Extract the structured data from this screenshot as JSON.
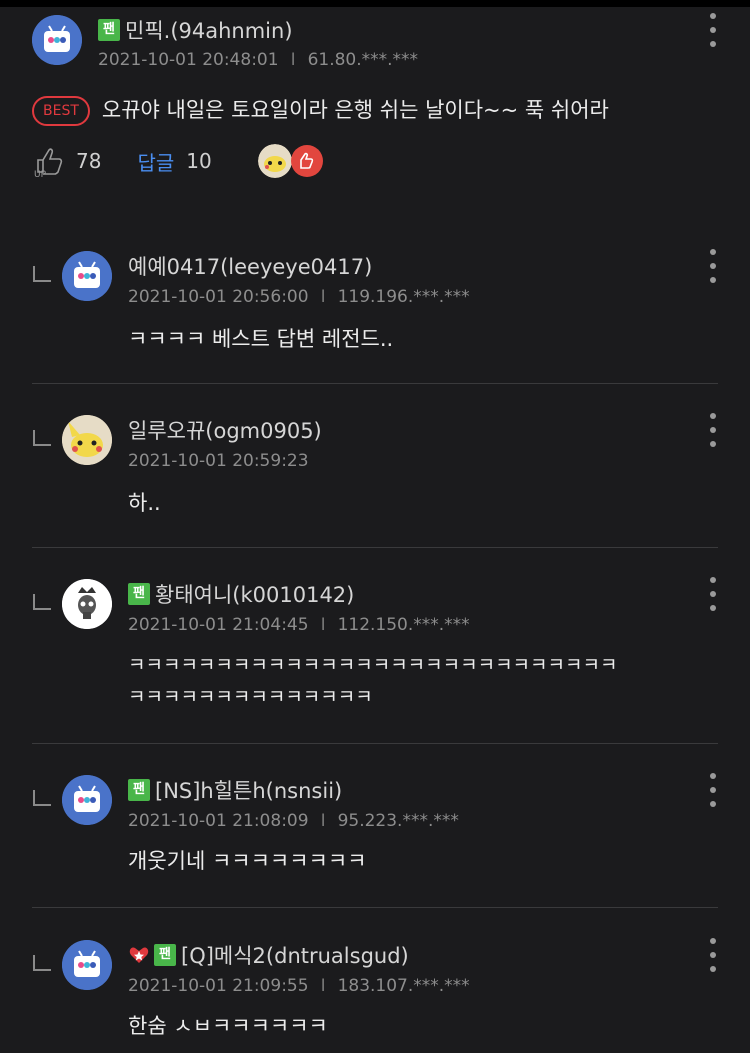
{
  "top_comment": {
    "fan_badge": "팬",
    "username": "민픽.(94ahnmin)",
    "datetime": "2021-10-01 20:48:01",
    "ip": "61.80.***.***",
    "best_label": "BEST",
    "text": "오뀨야 내일은 토요일이라 은행 쉬는 날이다~~ 푹 쉬어라",
    "like_count": "78",
    "reply_label": "답글",
    "reply_count": "10"
  },
  "replies": [
    {
      "username": "예예0417(leeyeye0417)",
      "datetime": "2021-10-01 20:56:00",
      "ip": "119.196.***.***",
      "text": "ㅋㅋㅋㅋ 베스트 답변 레전드..",
      "fan": false
    },
    {
      "username": "일루오뀨(ogm0905)",
      "datetime": "2021-10-01 20:59:23",
      "ip": "",
      "text": "하..",
      "fan": false
    },
    {
      "username": "황태여니(k0010142)",
      "datetime": "2021-10-01 21:04:45",
      "ip": "112.150.***.***",
      "text": "ㅋㅋㅋㅋㅋㅋㅋㅋㅋㅋㅋㅋㅋㅋㅋㅋㅋㅋㅋㅋㅋㅋㅋㅋㅋㅋㅋㅋ",
      "text2": "ㅋㅋㅋㅋㅋㅋㅋㅋㅋㅋㅋㅋㅋㅋ",
      "fan": true,
      "fan_badge": "팬"
    },
    {
      "username": "[NS]h힐튼h(nsnsii)",
      "datetime": "2021-10-01 21:08:09",
      "ip": "95.223.***.***",
      "text": "개웃기네 ㅋㅋㅋㅋㅋㅋㅋㅋ",
      "fan": true,
      "fan_badge": "팬"
    },
    {
      "username": "[Q]메식2(dntrualsgud)",
      "datetime": "2021-10-01 21:09:55",
      "ip": "183.107.***.***",
      "text": "한숨 ㅅㅂㅋㅋㅋㅋㅋㅋ",
      "fan": true,
      "fan_badge": "팬",
      "heart_badge": true
    }
  ],
  "colors": {
    "background": "#1b1b1d",
    "fan_green": "#49b64a",
    "best_red": "#e0393e",
    "reply_blue": "#4a8ef0"
  }
}
